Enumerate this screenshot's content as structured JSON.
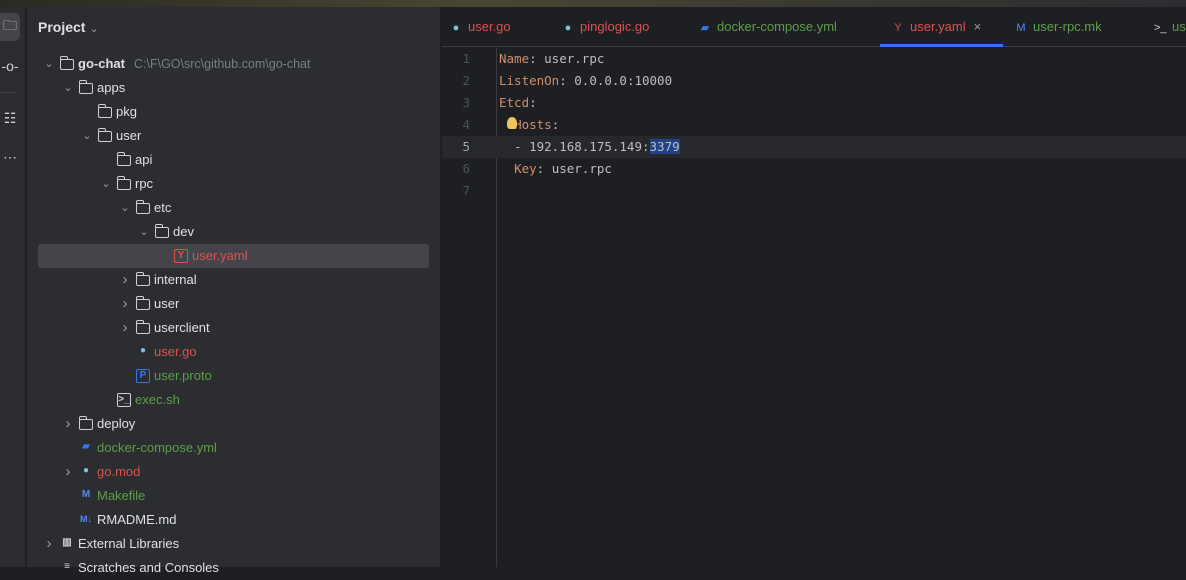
{
  "panel": {
    "title": "Project"
  },
  "tree": [
    {
      "label": "go-chat",
      "path": "C:\\F\\GO\\src\\github.com\\go-chat",
      "level": 0,
      "chevron": "down",
      "icon": "folder",
      "color": "#dfe1e5",
      "bold": true
    },
    {
      "label": "apps",
      "level": 1,
      "chevron": "down",
      "icon": "folder",
      "color": "#dfe1e5"
    },
    {
      "label": "pkg",
      "level": 2,
      "chevron": "none",
      "icon": "folder",
      "color": "#dfe1e5"
    },
    {
      "label": "user",
      "level": 2,
      "chevron": "down",
      "icon": "folder",
      "color": "#dfe1e5"
    },
    {
      "label": "api",
      "level": 3,
      "chevron": "none",
      "icon": "folder",
      "color": "#dfe1e5"
    },
    {
      "label": "rpc",
      "level": 3,
      "chevron": "down",
      "icon": "folder",
      "color": "#dfe1e5"
    },
    {
      "label": "etc",
      "level": 4,
      "chevron": "down",
      "icon": "folder",
      "color": "#dfe1e5"
    },
    {
      "label": "dev",
      "level": 5,
      "chevron": "down",
      "icon": "folder",
      "color": "#dfe1e5"
    },
    {
      "label": "user.yaml",
      "level": 6,
      "chevron": "none",
      "icon": "yaml",
      "color": "#d9534f",
      "selected": true
    },
    {
      "label": "internal",
      "level": 4,
      "chevron": "right",
      "icon": "folder",
      "color": "#dfe1e5"
    },
    {
      "label": "user",
      "level": 4,
      "chevron": "right",
      "icon": "folder",
      "color": "#dfe1e5"
    },
    {
      "label": "userclient",
      "level": 4,
      "chevron": "right",
      "icon": "folder",
      "color": "#dfe1e5"
    },
    {
      "label": "user.go",
      "level": 4,
      "chevron": "none",
      "icon": "gopher",
      "color": "#d9534f"
    },
    {
      "label": "user.proto",
      "level": 4,
      "chevron": "none",
      "icon": "proto",
      "color": "#5f9e49"
    },
    {
      "label": "exec.sh",
      "level": 3,
      "chevron": "none",
      "icon": "terminal",
      "color": "#5f9e49"
    },
    {
      "label": "deploy",
      "level": 1,
      "chevron": "right",
      "icon": "folder",
      "color": "#dfe1e5"
    },
    {
      "label": "docker-compose.yml",
      "level": 1,
      "chevron": "none",
      "icon": "docker",
      "color": "#5f9e49"
    },
    {
      "label": "go.mod",
      "level": 1,
      "chevron": "right",
      "icon": "gomod",
      "color": "#d9534f"
    },
    {
      "label": "Makefile",
      "level": 1,
      "chevron": "none",
      "icon": "makefile",
      "color": "#5f9e49"
    },
    {
      "label": "RMADME.md",
      "level": 1,
      "chevron": "none",
      "icon": "markdown",
      "color": "#dfe1e5"
    },
    {
      "label": "External Libraries",
      "level": 0,
      "chevron": "right",
      "icon": "library",
      "color": "#dfe1e5"
    },
    {
      "label": "Scratches and Consoles",
      "level": 0,
      "chevron": "none",
      "icon": "scratches",
      "color": "#dfe1e5"
    }
  ],
  "tabs": [
    {
      "label": "user.go",
      "icon": "gopher",
      "color": "#d9534f"
    },
    {
      "label": "pinglogic.go",
      "icon": "gopher",
      "color": "#d9534f"
    },
    {
      "label": "docker-compose.yml",
      "icon": "docker",
      "color": "#5f9e49"
    },
    {
      "label": "user.yaml",
      "icon": "yaml",
      "color": "#d9534f",
      "active": true
    },
    {
      "label": "user-rpc.mk",
      "icon": "makefile",
      "color": "#5f9e49"
    },
    {
      "label": "us",
      "icon": "terminal",
      "color": "#5f9e49"
    }
  ],
  "editor": {
    "current_line": 5,
    "lines": [
      {
        "n": "1",
        "parts": [
          {
            "t": "Name",
            "k": true
          },
          {
            "t": ": user.rpc"
          }
        ]
      },
      {
        "n": "2",
        "parts": [
          {
            "t": "ListenOn",
            "k": true
          },
          {
            "t": ": 0.0.0.0:10000"
          }
        ]
      },
      {
        "n": "3",
        "parts": [
          {
            "t": "Etcd",
            "k": true
          },
          {
            "t": ":"
          }
        ]
      },
      {
        "n": "4",
        "parts": [
          {
            "t": "  "
          },
          {
            "t": "Hosts",
            "k": true
          },
          {
            "t": ":"
          }
        ]
      },
      {
        "n": "5",
        "parts": [
          {
            "t": "  - 192.168.175.149:"
          },
          {
            "t": "3379",
            "sel": true
          }
        ]
      },
      {
        "n": "6",
        "parts": [
          {
            "t": "  "
          },
          {
            "t": "Key",
            "k": true
          },
          {
            "t": ": user.rpc"
          }
        ]
      },
      {
        "n": "7",
        "parts": []
      }
    ]
  },
  "colors": {
    "accent": "#3574f0",
    "selection": "#214283",
    "key": "#cf8e6d"
  }
}
